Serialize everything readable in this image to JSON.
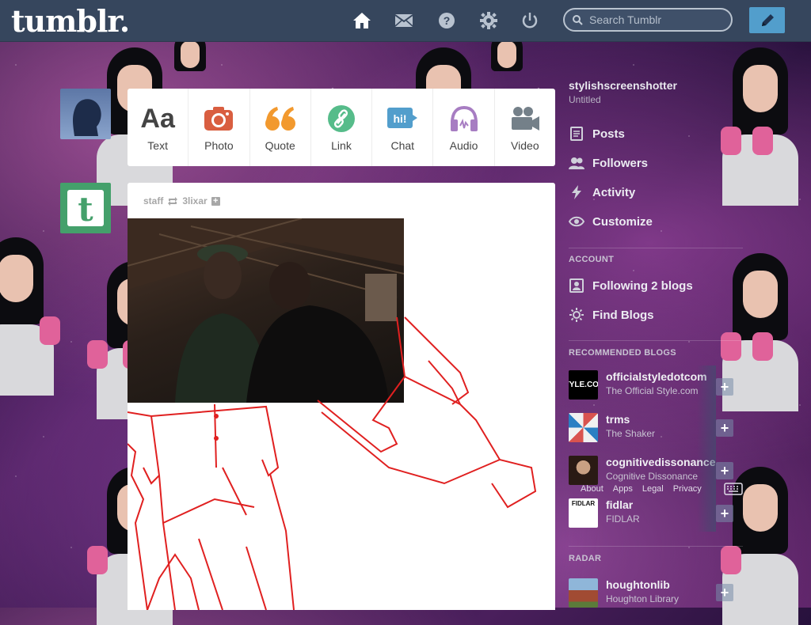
{
  "header": {
    "logo": "tumblr.",
    "search_placeholder": "Search Tumblr",
    "nav_icons": [
      "home-icon",
      "mail-icon",
      "help-icon",
      "gear-icon",
      "power-icon"
    ]
  },
  "post_types": [
    {
      "label": "Text",
      "color": "#444444"
    },
    {
      "label": "Photo",
      "color": "#d95e40"
    },
    {
      "label": "Quote",
      "color": "#f2992e"
    },
    {
      "label": "Link",
      "color": "#56bc8a"
    },
    {
      "label": "Chat",
      "color": "#529ecc"
    },
    {
      "label": "Audio",
      "color": "#a77dc2"
    },
    {
      "label": "Video",
      "color": "#748089"
    }
  ],
  "post": {
    "author": "staff",
    "reblogged_from": "3lixar"
  },
  "sidebar": {
    "blog_name": "stylishscreenshotter",
    "blog_subtitle": "Untitled",
    "items": [
      {
        "label": "Posts",
        "icon": "posts-icon"
      },
      {
        "label": "Followers",
        "icon": "followers-icon"
      },
      {
        "label": "Activity",
        "icon": "activity-icon"
      },
      {
        "label": "Customize",
        "icon": "eye-icon"
      }
    ],
    "account_heading": "ACCOUNT",
    "account_items": [
      {
        "label": "Following 2 blogs",
        "icon": "following-icon"
      },
      {
        "label": "Find Blogs",
        "icon": "find-blogs-icon"
      }
    ],
    "recommended_heading": "RECOMMENDED BLOGS",
    "recommended": [
      {
        "name": "officialstyledotcom",
        "desc": "The Official Style.com",
        "thumb_text": "STYLE.COM/"
      },
      {
        "name": "trms",
        "desc": "The Shaker",
        "thumb_text": ""
      },
      {
        "name": "cognitivedissonance",
        "desc": "Cognitive Dissonance",
        "thumb_text": ""
      },
      {
        "name": "fidlar",
        "desc": "FIDLAR",
        "thumb_text": "FIDLAR"
      }
    ],
    "footer_links": [
      "About",
      "Apps",
      "Legal",
      "Privacy"
    ],
    "radar_heading": "RADAR",
    "radar": {
      "name": "houghtonlib",
      "desc": "Houghton Library"
    }
  }
}
